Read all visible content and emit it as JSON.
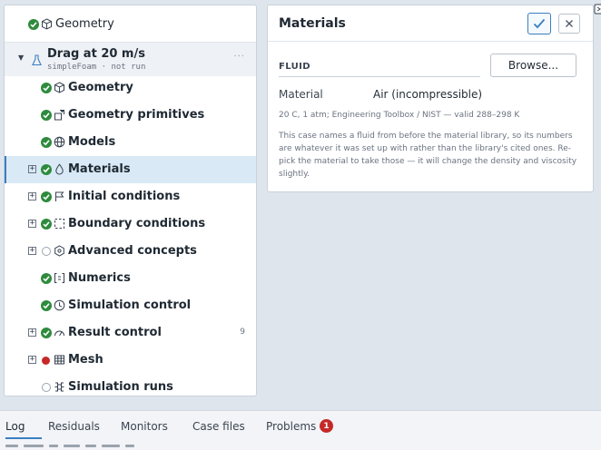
{
  "tree": {
    "top_item": {
      "label": "Geometry",
      "status": "ok",
      "icon": "cube-icon"
    },
    "case": {
      "title": "Drag at 20 m/s",
      "subtitle": "simpleFoam · not run"
    },
    "items": [
      {
        "label": "Geometry",
        "status": "ok",
        "icon": "cube-icon",
        "expandable": false
      },
      {
        "label": "Geometry primitives",
        "status": "ok",
        "icon": "shape-add-icon",
        "expandable": false
      },
      {
        "label": "Models",
        "status": "ok",
        "icon": "globe-icon",
        "expandable": false
      },
      {
        "label": "Materials",
        "status": "ok",
        "icon": "droplet-icon",
        "expandable": true,
        "selected": true
      },
      {
        "label": "Initial conditions",
        "status": "ok",
        "icon": "flag-icon",
        "expandable": true
      },
      {
        "label": "Boundary conditions",
        "status": "ok",
        "icon": "dashed-square-icon",
        "expandable": true
      },
      {
        "label": "Advanced concepts",
        "status": "pending",
        "icon": "hexagon-icon",
        "expandable": true
      },
      {
        "label": "Numerics",
        "status": "ok",
        "icon": "bracket-box-icon",
        "expandable": false
      },
      {
        "label": "Simulation control",
        "status": "ok",
        "icon": "clock-icon",
        "expandable": false
      },
      {
        "label": "Result control",
        "status": "ok",
        "icon": "gauge-icon",
        "expandable": true,
        "count": "9"
      },
      {
        "label": "Mesh",
        "status": "error",
        "icon": "grid-icon",
        "expandable": true
      },
      {
        "label": "Simulation runs",
        "status": "pending",
        "icon": "bug-icon",
        "expandable": false
      }
    ]
  },
  "materials": {
    "title": "Materials",
    "section": "FLUID",
    "browse_label": "Browse...",
    "material_key": "Material",
    "material_value": "Air (incompressible)",
    "meta": "20 C, 1 atm; Engineering Toolbox / NIST — valid 288–298 K",
    "note": "This case names a fluid from before the material library, so its numbers are whatever it was set up with rather than the library's cited ones. Re-pick the material to take those — it will change the density and viscosity slightly."
  },
  "bottom_tabs": [
    {
      "label": "Log",
      "active": true
    },
    {
      "label": "Residuals"
    },
    {
      "label": "Monitors"
    },
    {
      "label": "Case files"
    },
    {
      "label": "Problems",
      "badge": "1"
    }
  ],
  "colors": {
    "accent": "#3a7ec2",
    "ok": "#2e8b3d",
    "error": "#c62828",
    "selected": "#d9eaf6"
  }
}
